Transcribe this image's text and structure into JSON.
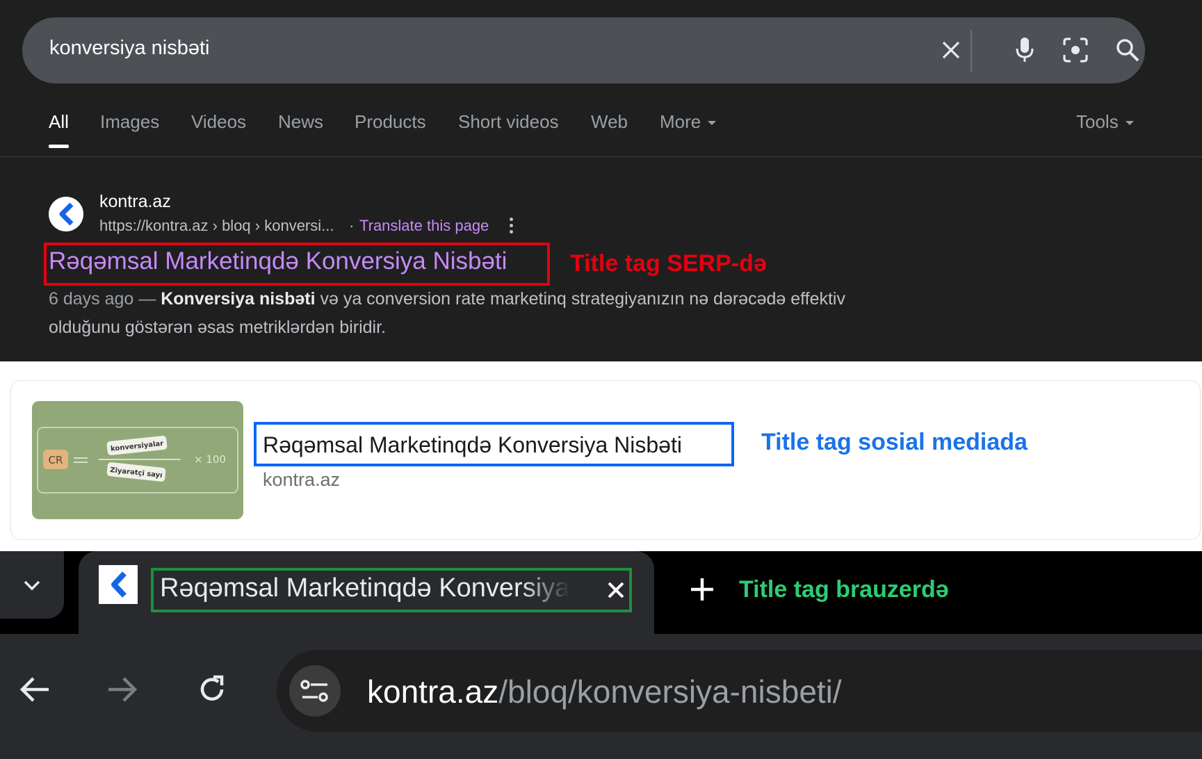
{
  "serp": {
    "query": "konversiya nisbəti",
    "tabs": [
      "All",
      "Images",
      "Videos",
      "News",
      "Products",
      "Short videos",
      "Web",
      "More"
    ],
    "tools": "Tools",
    "result": {
      "site_name": "kontra.az",
      "breadcrumb_url": "https://kontra.az › bloq › konversi...",
      "separator": "·",
      "translate": "Translate this page",
      "title": "Rəqəmsal Marketinqdə Konversiya Nisbəti",
      "date": "6 days ago —",
      "snippet_bold": "Konversiya nisbəti",
      "snippet_rest": " və ya conversion rate marketinq strategiyanızın nə dərəcədə effektiv olduğunu göstərən əsas metriklərdən biridir."
    },
    "annotation": "Title tag SERP-də",
    "annotation_color": "#e4000f"
  },
  "social": {
    "thumbnail": {
      "cr_label": "CR",
      "numerator": "konversiyalar",
      "denominator": "Ziyarətçi sayı",
      "multiplier": "× 100"
    },
    "title": "Rəqəmsal Marketinqdə Konversiya Nisbəti",
    "domain": "kontra.az",
    "annotation": "Title tag sosial mediada",
    "annotation_color": "#1a73e8"
  },
  "browser": {
    "tab_title": "Rəqəmsal Marketinqdə Konversiya Nisbəti",
    "annotation": "Title tag brauzerdə",
    "annotation_color": "#2ecc71",
    "url_host": "kontra.az",
    "url_path": "/bloq/konversiya-nisbeti/"
  }
}
